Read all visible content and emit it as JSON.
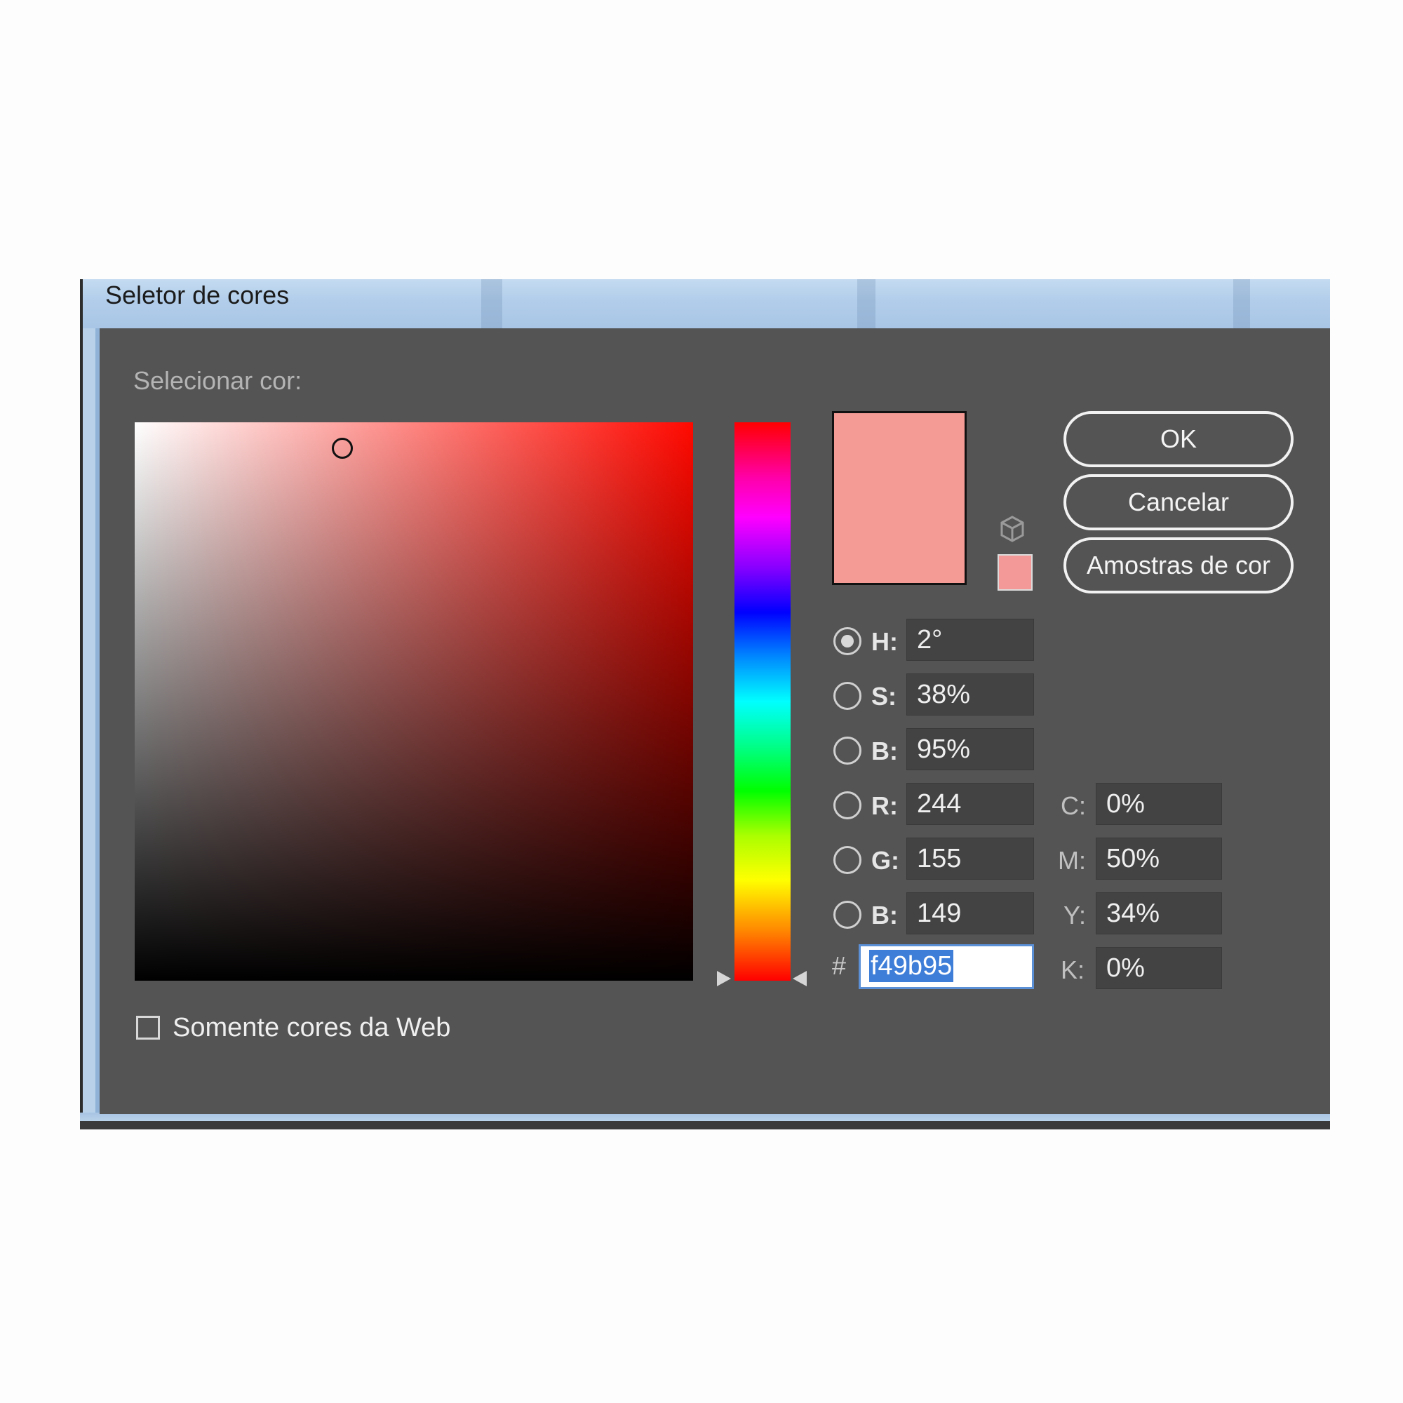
{
  "window": {
    "title": "Seletor de cores"
  },
  "dialog": {
    "select_label": "Selecionar cor:",
    "current_color": "#f49b95",
    "web_swatch_color": "#f39a98",
    "hue_color": "#ff0900",
    "buttons": {
      "ok": "OK",
      "cancel": "Cancelar",
      "swatches": "Amostras de cor"
    },
    "hsb": [
      {
        "label": "H:",
        "value": "2°",
        "selected": true
      },
      {
        "label": "S:",
        "value": "38%",
        "selected": false
      },
      {
        "label": "B:",
        "value": "95%",
        "selected": false
      }
    ],
    "rgb": [
      {
        "label": "R:",
        "value": "244",
        "selected": false
      },
      {
        "label": "G:",
        "value": "155",
        "selected": false
      },
      {
        "label": "B:",
        "value": "149",
        "selected": false
      }
    ],
    "hex": {
      "label": "#",
      "value": "f49b95"
    },
    "cmyk": [
      {
        "label": "C:",
        "value": "0%"
      },
      {
        "label": "M:",
        "value": "50%"
      },
      {
        "label": "Y:",
        "value": "34%"
      },
      {
        "label": "K:",
        "value": "0%"
      }
    ],
    "web_only": {
      "label": "Somente cores da Web",
      "checked": false
    }
  }
}
